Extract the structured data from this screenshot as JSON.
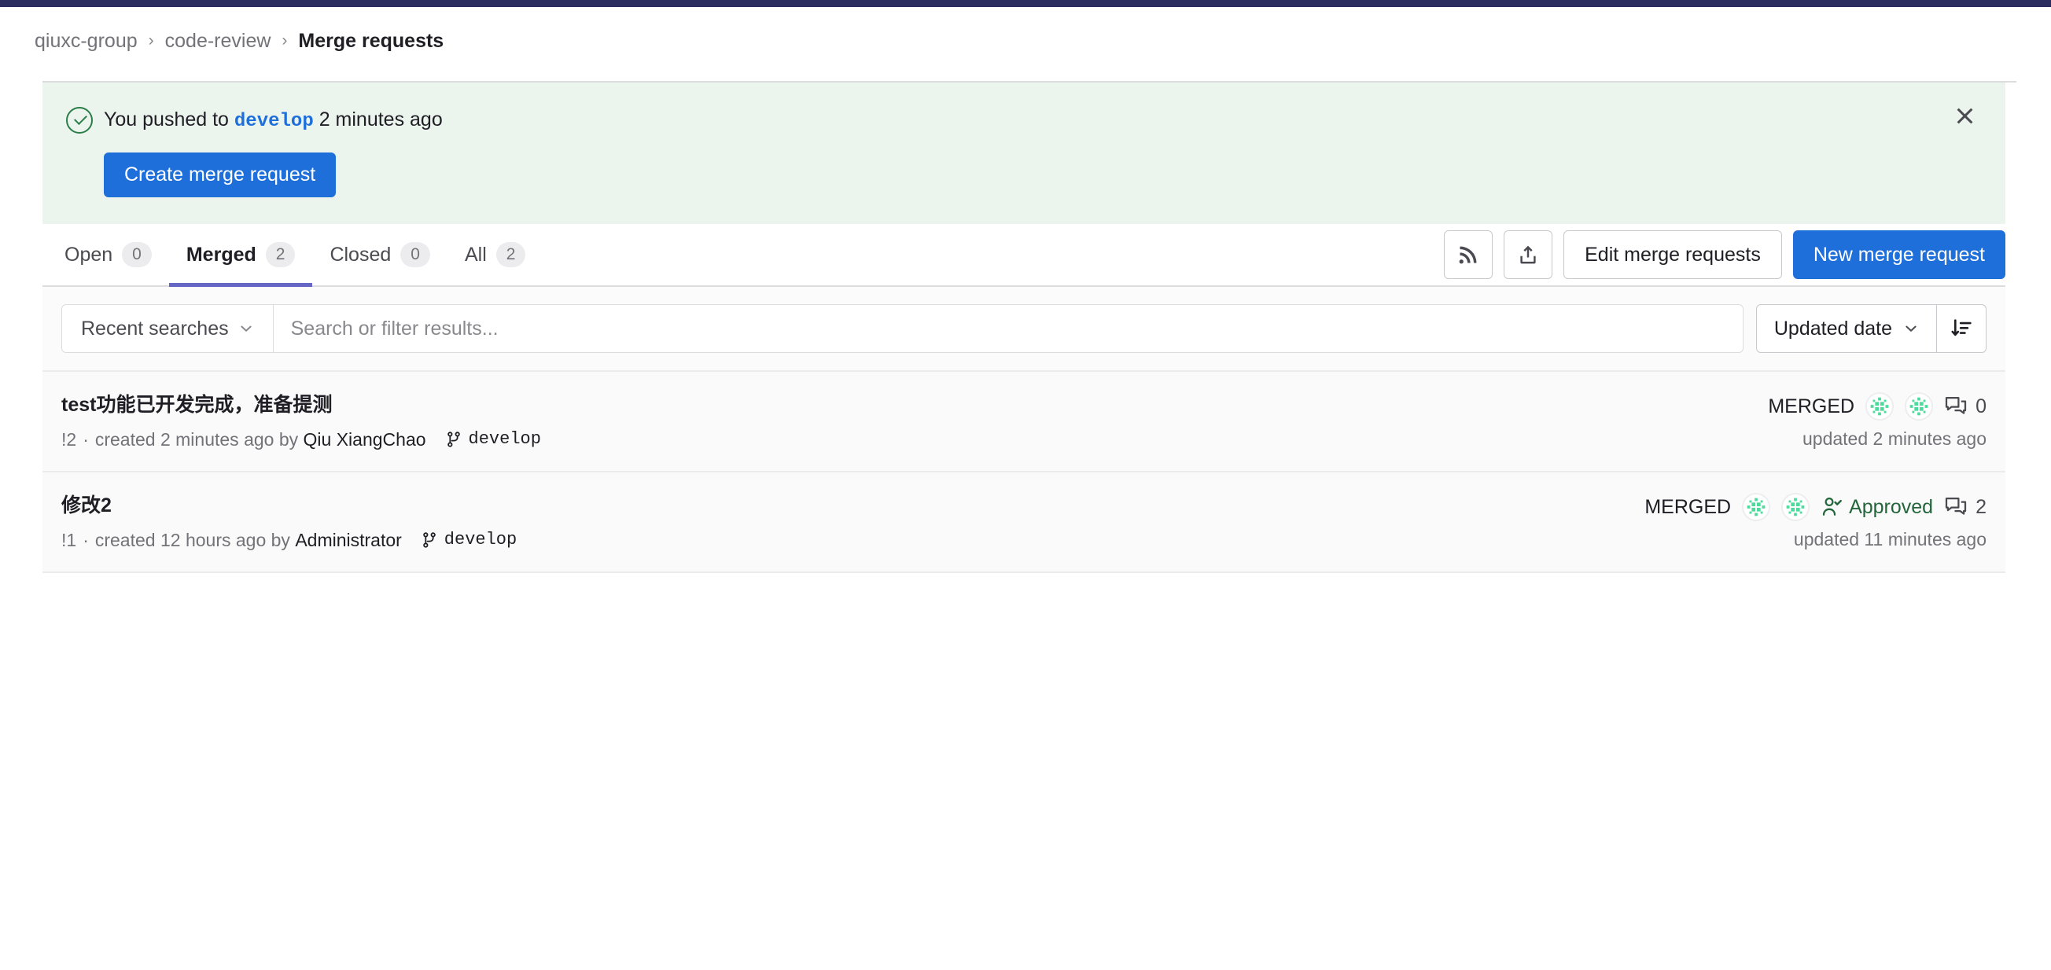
{
  "colors": {
    "top_strip": "#2b2d5e",
    "primary_button": "#1f6fdb",
    "banner_bg": "#ecf4ee",
    "active_tab_underline": "#6666c4",
    "approved_green": "#24663b",
    "row_bg": "#fafafa"
  },
  "breadcrumb": {
    "group": "qiuxc-group",
    "project": "code-review",
    "separator": "›",
    "current": "Merge requests"
  },
  "banner": {
    "icon": "check-circle-icon",
    "text_before": "You pushed to",
    "branch": "develop",
    "text_after": "2 minutes ago",
    "cta_label": "Create merge request",
    "close_icon": "close-icon"
  },
  "tabs": [
    {
      "label": "Open",
      "count": "0",
      "active": false
    },
    {
      "label": "Merged",
      "count": "2",
      "active": true
    },
    {
      "label": "Closed",
      "count": "0",
      "active": false
    },
    {
      "label": "All",
      "count": "2",
      "active": false
    }
  ],
  "tab_actions": {
    "rss_icon": "rss-feed-icon",
    "export_icon": "export-upload-icon",
    "edit_label": "Edit merge requests",
    "new_label": "New merge request"
  },
  "filters": {
    "recent_searches_label": "Recent searches",
    "chevron_icon": "chevron-down-icon",
    "search_placeholder": "Search or filter results...",
    "search_value": "",
    "sort_label": "Updated date",
    "sort_direction_icon": "sort-descending-icon"
  },
  "merge_requests": [
    {
      "title": "test功能已开发完成，准备提测",
      "iid": "!2",
      "separator": "·",
      "created": "created 2 minutes ago by",
      "author": "Qiu XiangChao",
      "branch_icon": "git-branch-icon",
      "branch": "develop",
      "status": "MERGED",
      "assignee_count": 2,
      "approved": false,
      "approved_label": "",
      "comment_icon": "comment-icon",
      "comments": "0",
      "updated": "updated 2 minutes ago"
    },
    {
      "title": "修改2",
      "iid": "!1",
      "separator": "·",
      "created": "created 12 hours ago by",
      "author": "Administrator",
      "branch_icon": "git-branch-icon",
      "branch": "develop",
      "status": "MERGED",
      "assignee_count": 2,
      "approved": true,
      "approved_label": "Approved",
      "approved_icon": "user-check-icon",
      "comment_icon": "comment-icon",
      "comments": "2",
      "updated": "updated 11 minutes ago"
    }
  ]
}
